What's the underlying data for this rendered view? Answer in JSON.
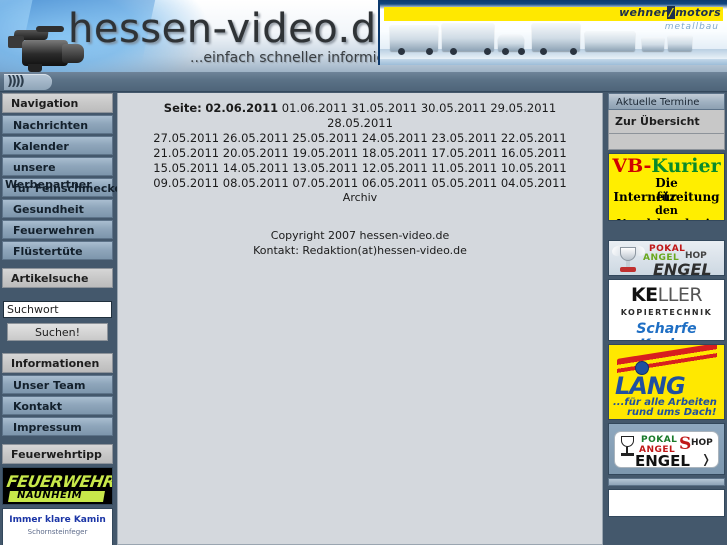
{
  "header": {
    "logo_title": "hessen-video.de",
    "logo_tagline": "...einfach schneller informiert!",
    "waves_icon": ")))) ",
    "banner": {
      "brand": "wehner",
      "brand_slash": "/",
      "brand2": "motors",
      "sub": "metallbau"
    }
  },
  "sidebar_left": {
    "sections": [
      {
        "title": "Navigation"
      },
      {
        "title": "Artikelsuche"
      },
      {
        "title": "Informationen"
      },
      {
        "title": "Feuerwehrtipp"
      }
    ],
    "nav_items": [
      {
        "label": "Nachrichten"
      },
      {
        "label": "Kalender"
      },
      {
        "label": "unsere",
        "label2": "Werbepartner"
      },
      {
        "label": "für Feinschmecker"
      },
      {
        "label": "Gesundheit"
      },
      {
        "label": "Feuerwehren"
      },
      {
        "label": "Flüsterture"
      }
    ],
    "nav_items_fixed": [
      "Nachrichten",
      "Kalender",
      "unsere",
      "Werbepartner",
      "für Feinschmecker",
      "Gesundheit",
      "Feuerwehren",
      "Flüstertüte"
    ],
    "search": {
      "value": "Suchwort",
      "placeholder": "Suchwort",
      "button_label": "Suchen!"
    },
    "info_items": [
      {
        "label": "Unser Team"
      },
      {
        "label": "Kontakt"
      },
      {
        "label": "Impressum"
      }
    ],
    "ads": [
      {
        "name": "feuerwehr-naunheim",
        "line1": "FEUERWEHR",
        "line2": "NAUNHEIM"
      },
      {
        "name": "kamin",
        "line1": "Immer klare Kamin",
        "line2": "Schornsteinfeger"
      }
    ]
  },
  "main": {
    "seite_label": "Seite:",
    "current_date": "02.06.2011",
    "date_rows": [
      [
        "01.06.2011",
        "31.05.2011",
        "30.05.2011",
        "29.05.2011",
        "28.05.2011"
      ],
      [
        "27.05.2011",
        "26.05.2011",
        "25.05.2011",
        "24.05.2011",
        "23.05.2011",
        "22.05.2011"
      ],
      [
        "21.05.2011",
        "20.05.2011",
        "19.05.2011",
        "18.05.2011",
        "17.05.2011",
        "16.05.2011"
      ],
      [
        "15.05.2011",
        "14.05.2011",
        "13.05.2011",
        "12.05.2011",
        "11.05.2011",
        "10.05.2011"
      ],
      [
        "09.05.2011",
        "08.05.2011",
        "07.05.2011",
        "06.05.2011",
        "05.05.2011",
        "04.05.2011"
      ]
    ],
    "archiv_label": "Archiv",
    "copyright_line1": "Copyright 2007 hessen-video.de",
    "copyright_line2": "Kontakt: Redaktion(at)hessen-video.de"
  },
  "sidebar_right": {
    "header": "Aktuelle Termine",
    "overview_link": "Zur Übersicht",
    "ads": [
      {
        "name": "vb-kurier",
        "l1a": "VB-",
        "l1b": "Kurier",
        "l2": "Die Internetzeitung",
        "l3": "für",
        "l4": "den Vogelsbergkreis"
      },
      {
        "name": "pokal-angel-shop-engel-1",
        "pokal": "POKAL",
        "angel": "ANGEL",
        "shop": "HOP",
        "engel": "ENGEL"
      },
      {
        "name": "keller-kopiertechnik",
        "l1a": "KE",
        "l1b": "LLER",
        "l2": "KOPIERTECHNIK",
        "l3": "Scharfe Kopien"
      },
      {
        "name": "lang-dach",
        "brand": "LANG",
        "s1": "...für alle Arbeiten",
        "s2": "rund ums Dach!"
      },
      {
        "name": "pokal-angel-shop-engel-2",
        "pokal": "POKAL",
        "angel": "ANGEL",
        "s": "S",
        "hop": "HOP",
        "engel": "ENGEL"
      }
    ]
  },
  "colors": {
    "page_bg": "#44586c",
    "content_bg": "#d4d8dd",
    "nav_item": "#8fa6bb",
    "section_head": "#c8c8c8",
    "accent_yellow": "#ffe800",
    "accent_blue": "#1f4fa0"
  }
}
